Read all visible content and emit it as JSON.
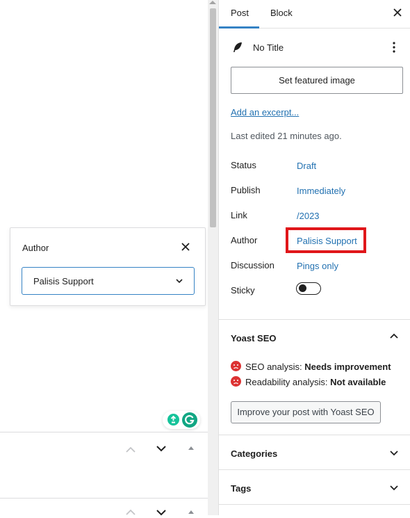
{
  "author_popover": {
    "title": "Author",
    "selected_author": "Palisis Support"
  },
  "sidebar": {
    "tabs": [
      "Post",
      "Block"
    ],
    "post_title": "No Title",
    "featured_image_button": "Set featured image",
    "excerpt_link": "Add an excerpt...",
    "last_edited": "Last edited 21 minutes ago.",
    "meta": [
      {
        "label": "Status",
        "value": "Draft"
      },
      {
        "label": "Publish",
        "value": "Immediately"
      },
      {
        "label": "Link",
        "value": "/2023"
      },
      {
        "label": "Author",
        "value": "Palisis Support"
      },
      {
        "label": "Discussion",
        "value": "Pings only"
      },
      {
        "label": "Sticky",
        "value": ""
      }
    ],
    "sticky_enabled": false,
    "yoast": {
      "title": "Yoast SEO",
      "seo_label": "SEO analysis: ",
      "seo_value": "Needs improvement",
      "readability_label": "Readability analysis: ",
      "readability_value": "Not available",
      "button": "Improve your post with Yoast SEO"
    },
    "categories_title": "Categories",
    "tags_title": "Tags"
  },
  "colors": {
    "link": "#2271b1",
    "highlight": "#e0161a",
    "focus": "#3582c4",
    "seo_bad": "#dc3232"
  }
}
